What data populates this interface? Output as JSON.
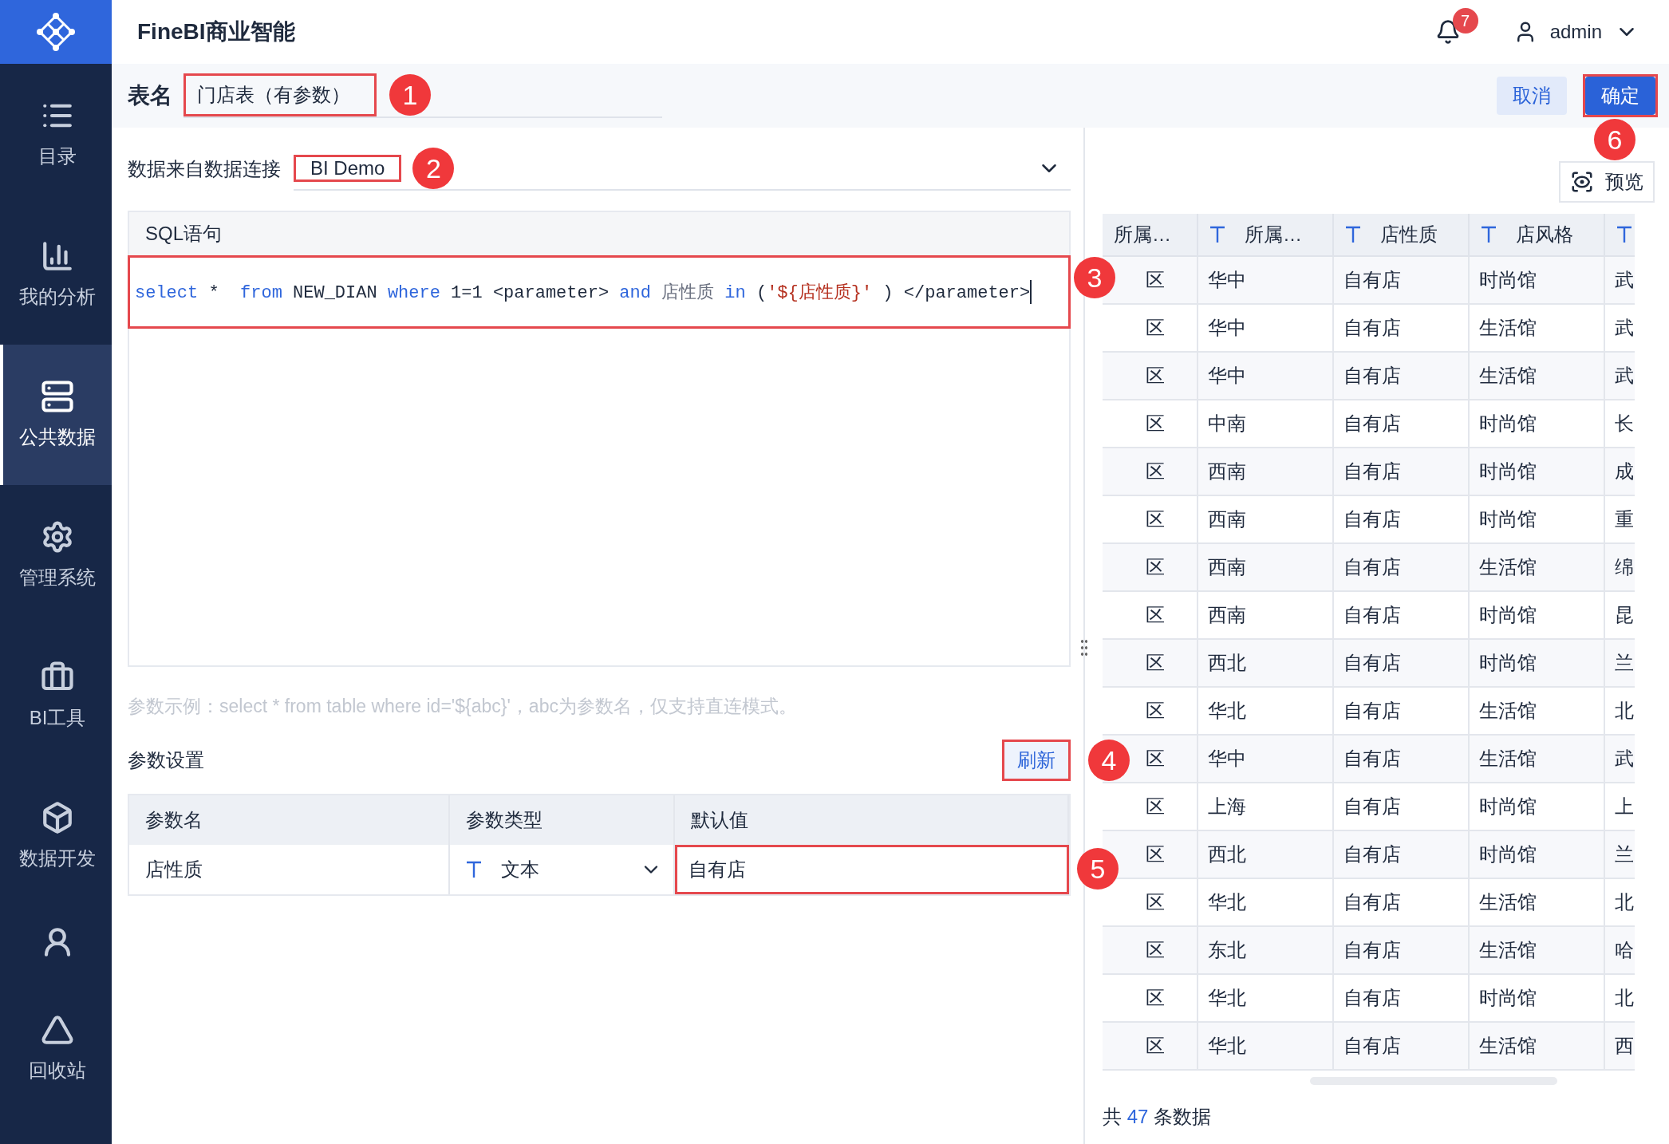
{
  "app": {
    "title": "FineBI商业智能",
    "notifications": "7",
    "user": "admin"
  },
  "sidebar": {
    "items": [
      {
        "label": "目录",
        "selected": false
      },
      {
        "label": "我的分析",
        "selected": false
      },
      {
        "label": "公共数据",
        "selected": true
      },
      {
        "label": "管理系统",
        "selected": false
      },
      {
        "label": "BI工具",
        "selected": false
      },
      {
        "label": "数据开发",
        "selected": false
      },
      {
        "selected": false
      },
      {
        "label": "回收站",
        "selected": false
      }
    ]
  },
  "header": {
    "label": "表名",
    "table_name": "门店表（有参数）",
    "table_name_highlighted": true,
    "table_name_marker": "1",
    "cancel": "取消",
    "confirm": "确定",
    "confirm_highlighted": true,
    "confirm_marker": "6"
  },
  "connection": {
    "label": "数据来自数据连接",
    "value": "BI Demo",
    "highlighted": true,
    "marker": "2"
  },
  "sql": {
    "title": "SQL语句",
    "highlighted": true,
    "marker": "3",
    "tokens": [
      {
        "text": "select",
        "kind": "keyword"
      },
      {
        "text": " *  ",
        "kind": "plain"
      },
      {
        "text": "from",
        "kind": "keyword"
      },
      {
        "text": " NEW_DIAN ",
        "kind": "plain"
      },
      {
        "text": "where",
        "kind": "keyword"
      },
      {
        "text": " 1=1 <parameter> ",
        "kind": "plain"
      },
      {
        "text": "and",
        "kind": "keyword"
      },
      {
        "text": " 店性质 ",
        "kind": "muted"
      },
      {
        "text": "in",
        "kind": "keyword"
      },
      {
        "text": " (",
        "kind": "plain"
      },
      {
        "text": "'${店性质}'",
        "kind": "string"
      },
      {
        "text": " ) </parameter>",
        "kind": "plain"
      }
    ]
  },
  "hint": "参数示例：select * from table where id='${abc}'，abc为参数名，仅支持直连模式。",
  "params": {
    "title": "参数设置",
    "refresh": "刷新",
    "refresh_highlighted": true,
    "refresh_marker": "4",
    "columns": [
      "参数名",
      "参数类型",
      "默认值"
    ],
    "rows": [
      {
        "name": "店性质",
        "type": "文本",
        "default": "自有店",
        "default_highlighted": true,
        "default_marker": "5"
      }
    ]
  },
  "preview": {
    "button": "预览"
  },
  "table": {
    "columns": [
      {
        "label": "所属…",
        "typed": false
      },
      {
        "label": "所属…",
        "typed": true
      },
      {
        "label": "店性质",
        "typed": true
      },
      {
        "label": "店风格",
        "typed": true
      },
      {
        "typed": true
      }
    ],
    "rows": [
      [
        "区",
        "华中",
        "自有店",
        "时尚馆",
        "武"
      ],
      [
        "区",
        "华中",
        "自有店",
        "生活馆",
        "武"
      ],
      [
        "区",
        "华中",
        "自有店",
        "生活馆",
        "武"
      ],
      [
        "区",
        "中南",
        "自有店",
        "时尚馆",
        "长"
      ],
      [
        "区",
        "西南",
        "自有店",
        "时尚馆",
        "成"
      ],
      [
        "区",
        "西南",
        "自有店",
        "时尚馆",
        "重"
      ],
      [
        "区",
        "西南",
        "自有店",
        "生活馆",
        "绵"
      ],
      [
        "区",
        "西南",
        "自有店",
        "时尚馆",
        "昆"
      ],
      [
        "区",
        "西北",
        "自有店",
        "时尚馆",
        "兰"
      ],
      [
        "区",
        "华北",
        "自有店",
        "生活馆",
        "北"
      ],
      [
        "区",
        "华中",
        "自有店",
        "生活馆",
        "武"
      ],
      [
        "区",
        "上海",
        "自有店",
        "时尚馆",
        "上"
      ],
      [
        "区",
        "西北",
        "自有店",
        "时尚馆",
        "兰"
      ],
      [
        "区",
        "华北",
        "自有店",
        "生活馆",
        "北"
      ],
      [
        "区",
        "东北",
        "自有店",
        "生活馆",
        "哈"
      ],
      [
        "区",
        "华北",
        "自有店",
        "时尚馆",
        "北"
      ],
      [
        "区",
        "华北",
        "自有店",
        "生活馆",
        "西"
      ]
    ],
    "footer": {
      "prefix": "共",
      "count": "47",
      "suffix": "条数据"
    }
  }
}
